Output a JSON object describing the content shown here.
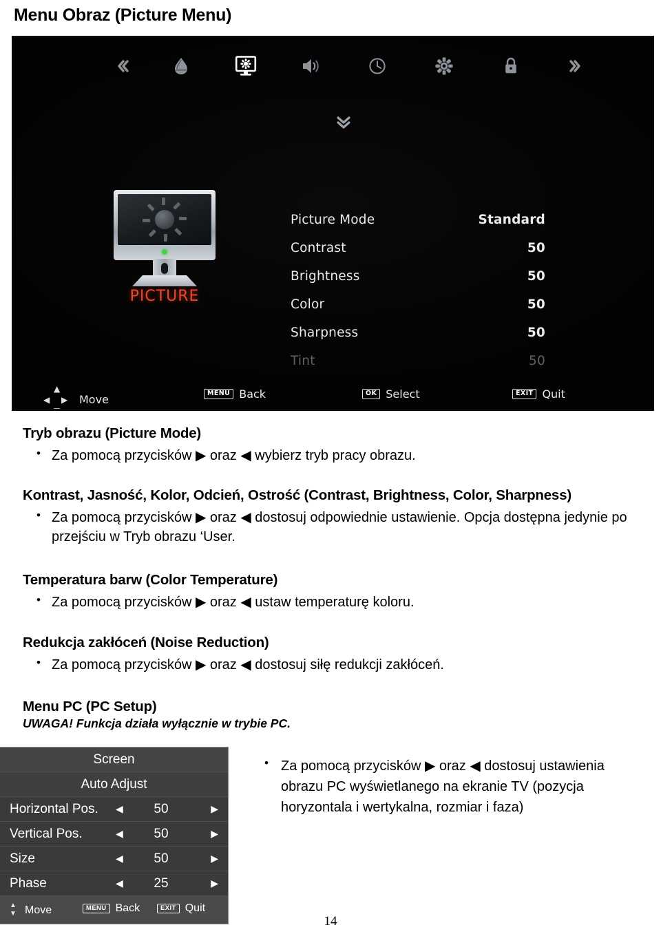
{
  "page": {
    "title": "Menu Obraz (Picture Menu)",
    "number": "14"
  },
  "tv_osd": {
    "icons": [
      {
        "name": "chevron-left-icon",
        "glyph": "«",
        "state": "dim"
      },
      {
        "name": "source-icon",
        "glyph": "",
        "state": "dim"
      },
      {
        "name": "picture-icon",
        "glyph": "",
        "state": "selected"
      },
      {
        "name": "sound-icon",
        "glyph": "",
        "state": "dim"
      },
      {
        "name": "time-icon",
        "glyph": "",
        "state": "dim"
      },
      {
        "name": "setup-icon",
        "glyph": "",
        "state": "dim"
      },
      {
        "name": "lock-icon",
        "glyph": "",
        "state": "dim"
      },
      {
        "name": "chevron-right-icon",
        "glyph": "»",
        "state": "dim"
      }
    ],
    "scroll_down_glyph": "»",
    "badge_label": "PICTURE",
    "menu": [
      {
        "label": "Picture Mode",
        "value": "Standard",
        "disabled": false
      },
      {
        "label": "Contrast",
        "value": "50",
        "disabled": false
      },
      {
        "label": "Brightness",
        "value": "50",
        "disabled": false
      },
      {
        "label": "Color",
        "value": "50",
        "disabled": false
      },
      {
        "label": "Sharpness",
        "value": "50",
        "disabled": false
      },
      {
        "label": "Tint",
        "value": "50",
        "disabled": true
      }
    ],
    "hints": {
      "move": "Move",
      "back_key": "MENU",
      "back": "Back",
      "select_key": "OK",
      "select": "Select",
      "quit_key": "EXIT",
      "quit": "Quit"
    }
  },
  "sections": {
    "picture_mode": {
      "heading": "Tryb obrazu (Picture Mode)",
      "bullet": "Za pomocą przycisków ▶ oraz ◀ wybierz tryb pracy obrazu."
    },
    "contrast_group": {
      "heading": "Kontrast, Jasność, Kolor, Odcień, Ostrość (Contrast, Brightness, Color, Sharpness)",
      "bullet": "Za pomocą przycisków ▶ oraz ◀ dostosuj odpowiednie ustawienie. Opcja dostępna jedynie po przejściu w Tryb obrazu ‘User."
    },
    "color_temperature": {
      "heading": "Temperatura barw (Color Temperature)",
      "bullet": "Za pomocą przycisków ▶ oraz ◀ ustaw temperaturę koloru."
    },
    "noise_reduction": {
      "heading": "Redukcja zakłóceń (Noise Reduction)",
      "bullet": "Za pomocą przycisków ▶ oraz ◀ dostosuj siłę redukcji zakłóceń."
    },
    "pc_menu": {
      "heading": "Menu PC (PC Setup)",
      "note": "UWAGA! Funkcja działa wyłącznie w trybie PC.",
      "bullet": "Za pomocą przycisków ▶ oraz ◀ dostosuj ustawienia obrazu PC wyświetlanego na ekranie TV (pozycja horyzontala i wertykalna, rozmiar i faza)"
    }
  },
  "pc_osd": {
    "title": "Screen",
    "action": "Auto Adjust",
    "rows": [
      {
        "label": "Horizontal Pos.",
        "value": "50"
      },
      {
        "label": "Vertical Pos.",
        "value": "50"
      },
      {
        "label": "Size",
        "value": "50"
      },
      {
        "label": "Phase",
        "value": "25"
      }
    ],
    "left_arrow": "◀",
    "right_arrow": "▶",
    "hints": {
      "move": "Move",
      "back_key": "MENU",
      "back": "Back",
      "quit_key": "EXIT",
      "quit": "Quit"
    }
  },
  "colors": {
    "picture_label": "#f0452b",
    "osd_background": "#030303",
    "pc_osd_background": "#3a3a3a"
  }
}
